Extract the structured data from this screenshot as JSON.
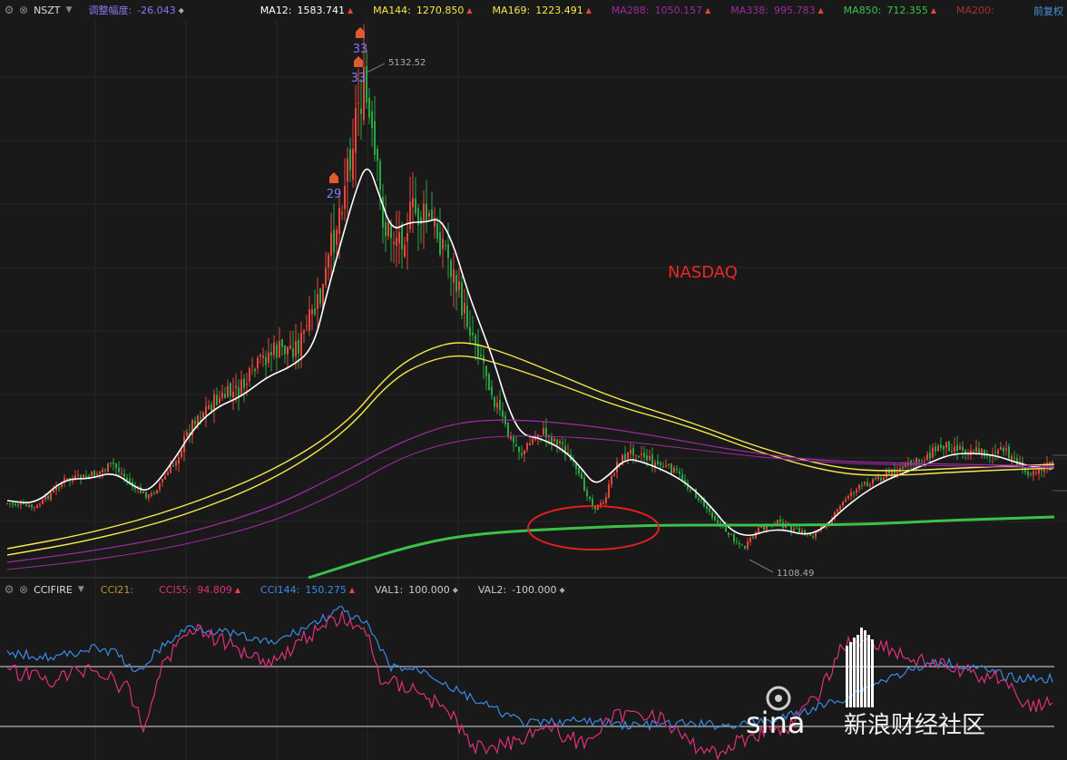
{
  "toolbar": {
    "symbol": "NSZT",
    "adjust_label": "调整幅度:",
    "adjust_value": "-26.043",
    "right_link": "前复权"
  },
  "ma_items": [
    {
      "label": "MA12:",
      "value": "1583.741",
      "color": "#ffffff"
    },
    {
      "label": "MA144:",
      "value": "1270.850",
      "color": "#f5e84a"
    },
    {
      "label": "MA169:",
      "value": "1223.491",
      "color": "#f5e84a"
    },
    {
      "label": "MA288:",
      "value": "1050.157",
      "color": "#9b2aa0"
    },
    {
      "label": "MA338:",
      "value": "995.783",
      "color": "#9b2aa0"
    },
    {
      "label": "MA850:",
      "value": "712.355",
      "color": "#3cc04a"
    },
    {
      "label": "MA200:",
      "value": "",
      "color": "#a83030"
    }
  ],
  "indicator_bar": {
    "name": "CCIFIRE",
    "items": [
      {
        "label": "CCI21:",
        "value": "",
        "color": "#c09030"
      },
      {
        "label": "CCI55:",
        "value": "94.809",
        "color": "#e0307a"
      },
      {
        "label": "CCI144:",
        "value": "150.275",
        "color": "#3a8ae8"
      },
      {
        "label": "VAL1:",
        "value": "100.000",
        "color": "#cccccc"
      },
      {
        "label": "VAL2:",
        "value": "-100.000",
        "color": "#cccccc"
      }
    ]
  },
  "annotations": {
    "title": "NASDAQ",
    "high_label": "5132.52",
    "low_label": "1108.49",
    "markers": [
      "33",
      "33",
      "29"
    ],
    "watermark": "新浪财经社区"
  },
  "colors": {
    "background": "#191919",
    "up_candle": "#e8453c",
    "down_candle": "#28a745",
    "ma12": "#ffffff",
    "ma144_169": "#f5e84a",
    "ma288_338": "#9b2aa0",
    "ma850": "#3cc04a",
    "cci55": "#e0307a",
    "cci144": "#3a8ae8",
    "highlight_ellipse": "#e02020"
  },
  "chart_data": {
    "type": "line",
    "title": "NASDAQ",
    "price_extremes": {
      "high": 5132.52,
      "low": 1108.49
    },
    "moving_averages": [
      {
        "name": "MA12",
        "last": 1583.741
      },
      {
        "name": "MA144",
        "last": 1270.85
      },
      {
        "name": "MA169",
        "last": 1223.491
      },
      {
        "name": "MA288",
        "last": 1050.157
      },
      {
        "name": "MA338",
        "last": 995.783
      },
      {
        "name": "MA850",
        "last": 712.355
      }
    ],
    "indicator": {
      "name": "CCIFIRE",
      "series": [
        {
          "name": "CCI55",
          "last": 94.809
        },
        {
          "name": "CCI144",
          "last": 150.275
        }
      ],
      "levels": [
        100.0,
        -100.0
      ]
    },
    "grid": true
  }
}
